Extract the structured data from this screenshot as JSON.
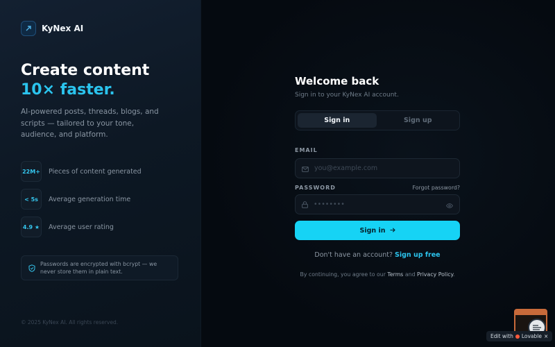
{
  "brand": {
    "name": "KyNex AI"
  },
  "hero": {
    "headline_line1": "Create content",
    "headline_accent": "10× faster.",
    "subcopy": "AI-powered posts, threads, blogs, and scripts — tailored to your tone, audience, and platform."
  },
  "stats": [
    {
      "badge": "22M+",
      "label": "Pieces of content generated"
    },
    {
      "badge": "< 5s",
      "label": "Average generation time"
    },
    {
      "badge": "4.9 ★",
      "label": "Average user rating"
    }
  ],
  "security_note": "Passwords are encrypted with bcrypt — we never store them in plain text.",
  "copyright": "© 2025 KyNex AI. All rights reserved.",
  "form": {
    "title": "Welcome back",
    "subtitle": "Sign in to your KyNex AI account.",
    "tabs": [
      {
        "label": "Sign in",
        "active": true
      },
      {
        "label": "Sign up",
        "active": false
      }
    ],
    "email_label": "EMAIL",
    "email_placeholder": "you@example.com",
    "password_label": "PASSWORD",
    "forgot_label": "Forgot password?",
    "password_placeholder": "••••••••",
    "submit_label": "Sign in",
    "no_account_text": "Don't have an account?",
    "signup_link": "Sign up free",
    "terms_prefix": "By continuing, you agree to our",
    "terms_link": "Terms",
    "terms_and": "and",
    "privacy_link": "Privacy Policy",
    "terms_suffix": "."
  },
  "edit_badge": {
    "prefix": "Edit with",
    "brand": "Lovable"
  },
  "colors": {
    "accent": "#16d3f5",
    "accent_text": "#2bc4ee",
    "background": "#060b12",
    "panel": "#0d1824"
  }
}
